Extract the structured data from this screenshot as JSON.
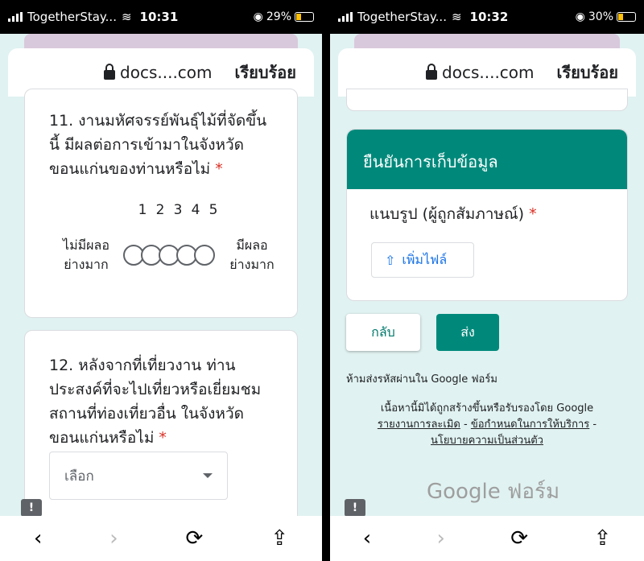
{
  "left": {
    "status": {
      "carrier": "TogetherStay...",
      "time": "10:31",
      "battery": "29%"
    },
    "url": {
      "host": "docs....com",
      "done": "เรียบร้อย"
    },
    "q11": {
      "text": "11. งานมหัศจรรย์พันธุ์ไม้ที่จัดขึ้นนี้ มีผลต่อการเข้ามาในจังหวัดขอนแก่นของท่านหรือไม่",
      "required": "*",
      "scale": [
        "1",
        "2",
        "3",
        "4",
        "5"
      ],
      "low_label_1": "ไม่มีผลอ",
      "low_label_2": "ย่างมาก",
      "high_label_1": "มีผลอ",
      "high_label_2": "ย่างมาก"
    },
    "q12": {
      "text": "12. หลังจากที่เที่ยวงาน ท่านประสงค์ที่จะไปเที่ยวหรือเยี่ยมชมสถานที่ท่องเที่ยวอื่น ในจังหวัดขอนแก่นหรือไม่",
      "required": "*",
      "select_value": "เลือก"
    },
    "feedback_icon": "!"
  },
  "right": {
    "status": {
      "carrier": "TogetherStay...",
      "time": "10:32",
      "battery": "30%"
    },
    "url": {
      "host": "docs....com",
      "done": "เรียบร้อย"
    },
    "section_title": "ยืนยันการเก็บข้อมูล",
    "upload_question": "แนบรูป (ผู้ถูกสัมภาษณ์)",
    "required": "*",
    "upload_label": "เพิ่มไฟล์",
    "back_label": "กลับ",
    "submit_label": "ส่ง",
    "password_warning": "ห้ามส่งรหัสผ่านใน Google ฟอร์ม",
    "disclaimer": "เนื้อหานี้มิได้ถูกสร้างขึ้นหรือรับรองโดย Google",
    "report_abuse": "รายงานการละเมิด",
    "sep1": " - ",
    "terms": "ข้อกำหนดในการให้บริการ",
    "sep2": " -",
    "privacy": "นโยบายความเป็นส่วนตัว",
    "brand": "Google ฟอร์ม",
    "feedback_icon": "!"
  },
  "toolbar": {
    "back": "‹",
    "forward": "›",
    "reload": "⟳",
    "share": "⇪"
  },
  "colors": {
    "accent": "#00897b",
    "background": "#e0f2f1",
    "required": "#d93025",
    "link": "#1a73e8"
  }
}
